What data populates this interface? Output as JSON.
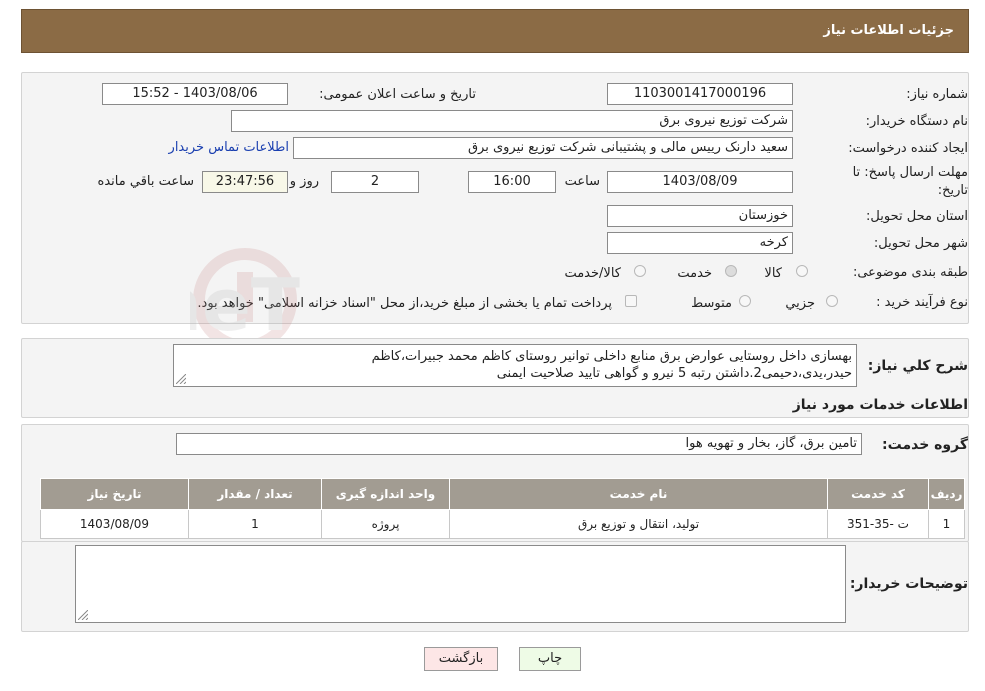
{
  "header": {
    "title": "جزئیات اطلاعات نیاز"
  },
  "form": {
    "need_number_label": "شماره نیاز:",
    "need_number": "1103001417000196",
    "announce_label": "تاریخ و ساعت اعلان عمومی:",
    "announce_value": "1403/08/06 - 15:52",
    "buyer_org_label": "نام دستگاه خریدار:",
    "buyer_org": "شرکت توزیع نیروی برق",
    "requester_label": "ایجاد کننده درخواست:",
    "requester": "سعید دارنک رییس مالی و پشتیبانی  شرکت توزیع نیروی برق",
    "contact_link": "اطلاعات تماس خریدار",
    "deadline_label_1": "مهلت ارسال پاسخ: تا",
    "deadline_label_2": "تاریخ:",
    "deadline_date": "1403/08/09",
    "time_label": "ساعت",
    "deadline_time": "16:00",
    "days_value": "2",
    "days_label": "روز و",
    "remaining_time": "23:47:56",
    "remaining_label": "ساعت باقي مانده",
    "province_label": "استان محل تحویل:",
    "province": "خوزستان",
    "city_label": "شهر محل تحویل:",
    "city": "کرخه",
    "category_label": "طبقه بندی موضوعی:",
    "category_options": [
      "کالا",
      "خدمت",
      "کالا/خدمت"
    ],
    "category_selected": "خدمت",
    "process_label": "نوع فرآیند خرید :",
    "process_options": [
      "جزیي",
      "متوسط"
    ],
    "process_note": "پرداخت تمام یا بخشی از مبلغ خرید،از محل \"اسناد خزانه اسلامی\" خواهد بود."
  },
  "description": {
    "label": "شرح كلي نياز:",
    "line1": "بهسازی داخل روستایی عوارض برق منابع داخلی توانیر روستای کاظم محمد جبیرات،کاظم",
    "line2": "حیدر،یدی،دحیمی2.داشتن رتبه 5 نیرو و گواهی تایید صلاحیت ایمنی"
  },
  "services": {
    "section_title": "اطلاعات خدمات مورد نياز",
    "group_label": "گروه خدمت:",
    "group_value": "تامین برق، گاز، بخار و تهویه هوا",
    "table_headers": [
      "رديف",
      "کد خدمت",
      "نام خدمت",
      "واحد اندازه گیری",
      "تعداد / مقدار",
      "تاریخ نیاز"
    ],
    "rows": [
      [
        "1",
        "ت -35-351",
        "تولید، انتقال و توزیع برق",
        "پروژه",
        "1",
        "1403/08/09"
      ]
    ]
  },
  "buyer_notes": {
    "label": "توضیحات خریدار:",
    "value": ""
  },
  "buttons": {
    "print": "چاپ",
    "back": "بازگشت"
  },
  "watermark": {
    "text": "AriaTender.neT"
  },
  "colors": {
    "header_bg": "#8b6b45",
    "table_header_bg": "#a29c92",
    "print_bg": "#eefbe6",
    "back_bg": "#fde6e6",
    "link": "#1a3fb0"
  }
}
